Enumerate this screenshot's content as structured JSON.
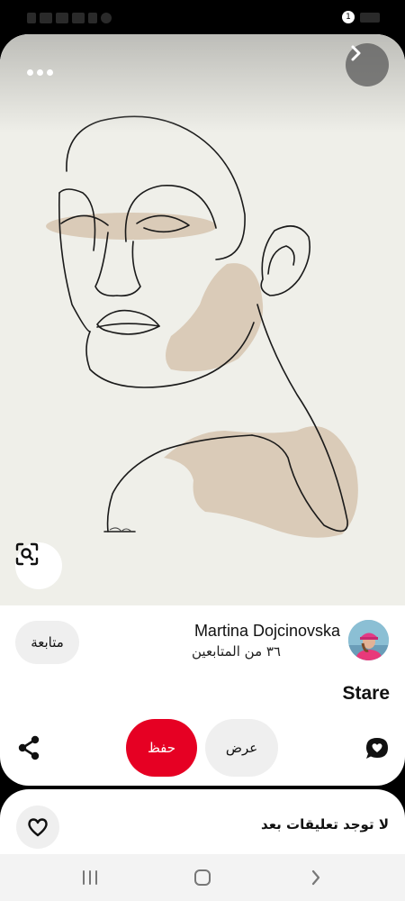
{
  "status_bar": {
    "notification_count": "1"
  },
  "pin": {
    "title": "Stare",
    "image_icons": {
      "more": "more-horizontal-icon",
      "next": "chevron-right-icon",
      "lens": "visual-search-icon"
    }
  },
  "creator": {
    "name": "Martina Dojcinovska",
    "followers": "٣٦ من المتابعين",
    "follow_label": "متابعة"
  },
  "actions": {
    "view_label": "عرض",
    "save_label": "حفظ",
    "share_icon": "share-icon",
    "comment_icon": "comment-icon"
  },
  "comments": {
    "empty_text": "لا توجد تعليقات بعد",
    "react_icon": "heart-icon"
  },
  "nav": {
    "recents": "recents-icon",
    "home": "home-icon",
    "back": "back-icon"
  },
  "colors": {
    "save": "#e60023",
    "skin": "#d9c8b5",
    "background": "#efefe9"
  }
}
